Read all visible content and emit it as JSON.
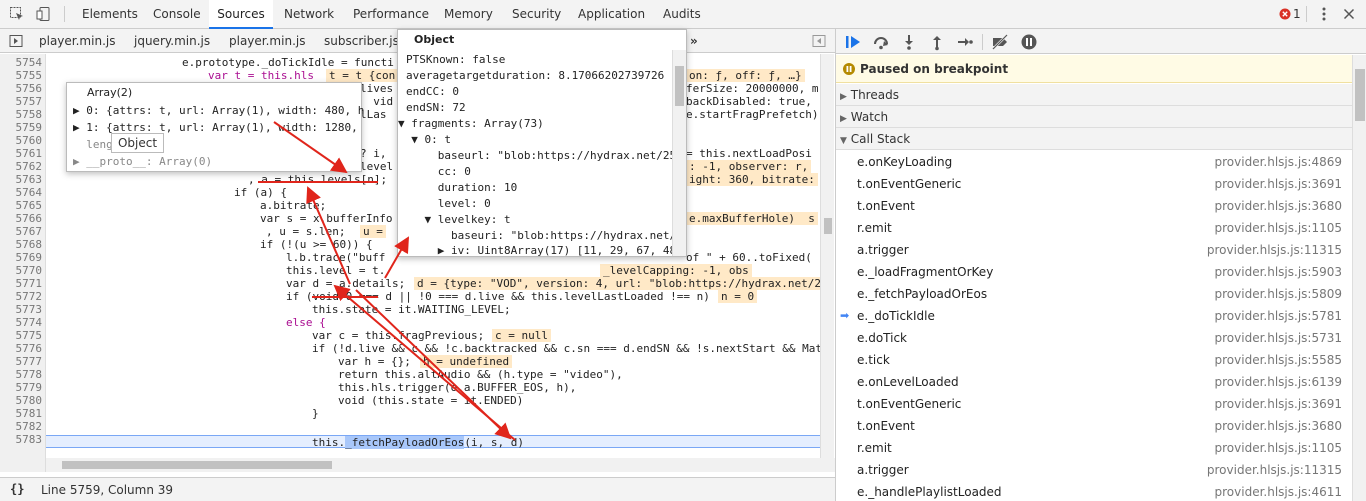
{
  "toolbar": {
    "tabs": [
      "Elements",
      "Console",
      "Sources",
      "Network",
      "Performance",
      "Memory",
      "Security",
      "Application",
      "Audits"
    ],
    "active_tab": "Sources",
    "error_count": "1",
    "icons": [
      "inspect-icon",
      "device-toolbar-icon",
      "error-icon",
      "more-menu-icon",
      "close-icon"
    ],
    "error_color": "#d93025"
  },
  "file_tabs": {
    "files": [
      "player.min.js",
      "jquery.min.js",
      "player.min.js",
      "subscriber.js"
    ],
    "overflow": "»"
  },
  "editor": {
    "accent": "#1a73e8",
    "line_numbers": [
      "5754",
      "5755",
      "5756",
      "5757",
      "5758",
      "5759",
      "5760",
      "5761",
      "5762",
      "5763",
      "5764",
      "5765",
      "5766",
      "5767",
      "5768",
      "5769",
      "5770",
      "5771",
      "5772",
      "5773",
      "5774",
      "5775",
      "5776",
      "5777",
      "5778",
      "5779",
      "5780",
      "5781",
      "5782",
      "5783"
    ],
    "lines": {
      "l5754": "e.prototype._doTickIdle = functi",
      "l5755": "var t = this.hls",
      "l5756": "lives",
      "l5757": "  vid",
      "l5758": "lLas",
      "l5760": "? i,",
      "l5761": "level",
      "l5762": ", a = this.levels[n];",
      "l5763": "if (a) {",
      "l5764": "a.bitrate;",
      "l5765": "var s = x.bufferInfo",
      "l5766": ", u = s.len;",
      "l5767": "if (!(u >= 60)) {",
      "l5768": "l.b.trace(\"buff",
      "l5769": "this.level = t.",
      "l5770": "var d = a.details;",
      "l5771": "if (void 0 === d || !0 === d.live && this.levelLastLoaded !== n)",
      "l5772": "this.state = it.WAITING_LEVEL;",
      "l5773": "else {",
      "l5774": "var c = this.fragPrevious;",
      "l5775": "if (!d.live && c && !c.backtracked && c.sn === d.endSN && !s.nextStart && Mat",
      "l5776": "var h = {};",
      "l5777": "return this.altAudio && (h.type = \"video\"),",
      "l5778": "this.hls.trigger(o.a.BUFFER_EOS, h),",
      "l5779": "void (this.state = it.ENDED)",
      "l5780": "}",
      "l5781a": "this.",
      "l5781b": "_fetchPayloadOrEos",
      "l5781c": "(i, s, d)"
    },
    "right_fragments": {
      "r5755": "t = t {con",
      "r5755b": "on: ƒ, off: ƒ, …}",
      "r5756": "ferSize: 20000000, m",
      "r5757": "backDisabled: true,",
      "r5758": "e.startFragPrefetch)",
      "r5760": "= this.nextLoadPosi",
      "r5761": ": -1, observer: r,",
      "r5762": "ight: 360, bitrate:",
      "r5765": "e.maxBufferHole)  s",
      "r5766": "u =",
      "r5768": "of \" + 60..toFixed(",
      "r5769": "_levelCapping: -1, obs",
      "r5770": "d = {type: \"VOD\", version: 4, url: \"blob:https://hydrax.net/2",
      "r5771": "n = 0",
      "r5774": "c = null",
      "r5776": "h = undefined"
    }
  },
  "array_popover": {
    "title": "Array(2)",
    "rows": [
      "▶ 0: {attrs: t, url: Array(1), width: 480, h",
      "▶ 1: {attrs: t, url: Array(1), width: 1280,",
      "  lengt",
      "▶ __proto__: Array(0)"
    ],
    "tooltip": "Object"
  },
  "object_popover": {
    "title": "Object",
    "rows": [
      "PTSKnown: false",
      "averagetargetduration: 8.17066202739726",
      "endCC: 0",
      "endSN: 72",
      "▼ fragments: Array(73)",
      "  ▼ 0: t",
      "      baseurl: \"blob:https://hydrax.net/25",
      "      cc: 0",
      "      duration: 10",
      "      level: 0",
      "    ▼ levelkey: t",
      "        baseuri: \"blob:https://hydrax.net/",
      "      ▶ iv: Uint8Array(17) [11, 29, 67, 48"
    ]
  },
  "status": {
    "position": "Line 5759, Column 39",
    "format_icon": "{}"
  },
  "sidebar": {
    "paused": "Paused on breakpoint",
    "threads": "Threads",
    "watch": "Watch",
    "call_stack": "Call Stack",
    "frames": [
      {
        "name": "e.onKeyLoading",
        "loc": "provider.hlsjs.js:4869"
      },
      {
        "name": "t.onEventGeneric",
        "loc": "provider.hlsjs.js:3691"
      },
      {
        "name": "t.onEvent",
        "loc": "provider.hlsjs.js:3680"
      },
      {
        "name": "r.emit",
        "loc": "provider.hlsjs.js:1105"
      },
      {
        "name": "a.trigger",
        "loc": "provider.hlsjs.js:11315"
      },
      {
        "name": "e._loadFragmentOrKey",
        "loc": "provider.hlsjs.js:5903"
      },
      {
        "name": "e._fetchPayloadOrEos",
        "loc": "provider.hlsjs.js:5809"
      },
      {
        "name": "e._doTickIdle",
        "loc": "provider.hlsjs.js:5781"
      },
      {
        "name": "e.doTick",
        "loc": "provider.hlsjs.js:5731"
      },
      {
        "name": "e.tick",
        "loc": "provider.hlsjs.js:5585"
      },
      {
        "name": "e.onLevelLoaded",
        "loc": "provider.hlsjs.js:6139"
      },
      {
        "name": "t.onEventGeneric",
        "loc": "provider.hlsjs.js:3691"
      },
      {
        "name": "t.onEvent",
        "loc": "provider.hlsjs.js:3680"
      },
      {
        "name": "r.emit",
        "loc": "provider.hlsjs.js:1105"
      },
      {
        "name": "a.trigger",
        "loc": "provider.hlsjs.js:11315"
      },
      {
        "name": "e._handlePlaylistLoaded",
        "loc": "provider.hlsjs.js:4611"
      }
    ],
    "current_frame_index": 7,
    "pause_icon_color": "#b58a00",
    "current_arrow_color": "#4285f4"
  },
  "annotation_color": "#e0251b"
}
